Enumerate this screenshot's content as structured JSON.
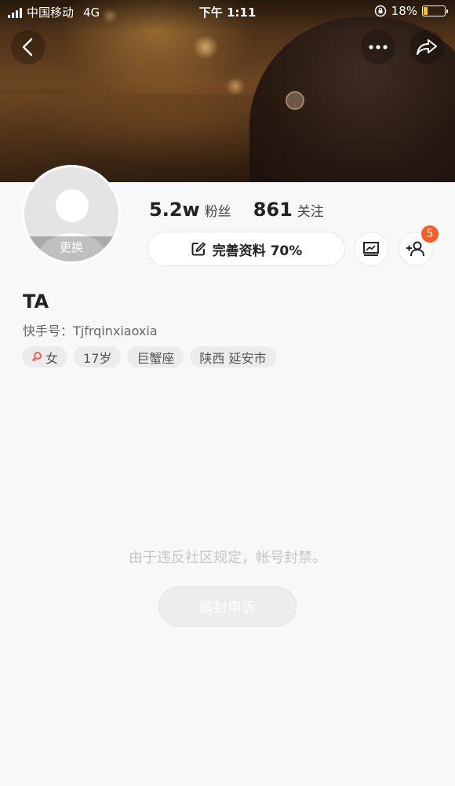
{
  "status_bar": {
    "carrier": "中国移动",
    "network": "4G",
    "time": "下午 1:11",
    "battery": "18%"
  },
  "header": {
    "back_icon": "chevron-left-icon",
    "more_icon": "more-dots-icon",
    "share_icon": "share-arrow-icon"
  },
  "profile": {
    "avatar_change_label": "更换",
    "followers_count": "5.2w",
    "followers_label": "粉丝",
    "following_count": "861",
    "following_label": "关注",
    "complete_profile_label": "完善资料 70%",
    "add_friend_badge": "5",
    "name": "TA",
    "user_id": "快手号：Tjfrqinxiaoxia",
    "tags": [
      "女",
      "17岁",
      "巨蟹座",
      "陕西 延安市"
    ]
  },
  "notice": {
    "message": "由于违反社区规定，帐号封禁。",
    "appeal_label": "解封申诉"
  },
  "colors": {
    "accent": "#ff5a1f",
    "background": "#f8f8f8",
    "female_icon": "#ff5a5a"
  }
}
